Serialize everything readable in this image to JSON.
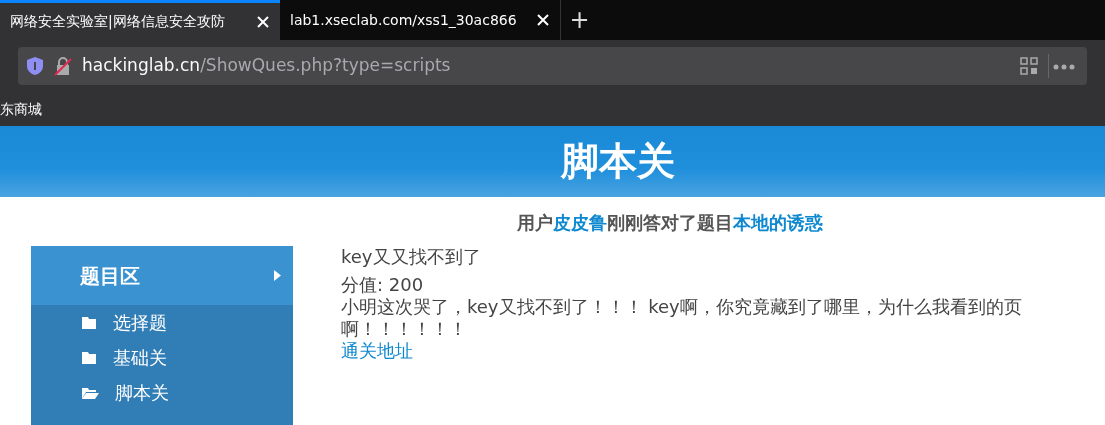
{
  "browser": {
    "tabs": [
      {
        "title": "网络安全实验室|网络信息安全攻防",
        "selected": true
      },
      {
        "title": "lab1.xseclab.com/xss1_30ac866",
        "selected": false
      }
    ],
    "new_tab": "+",
    "address": {
      "domain": "hackinglab.cn",
      "path": "/ShowQues.php?type=scripts"
    },
    "bookmarks": [
      "东商城"
    ]
  },
  "page": {
    "title": "脚本关",
    "notice_parts": [
      {
        "text": "用户",
        "kind": "plain"
      },
      {
        "text": "皮皮鲁",
        "kind": "link"
      },
      {
        "text": "刚刚答对了题目",
        "kind": "plain"
      },
      {
        "text": "本地的诱惑",
        "kind": "link"
      }
    ],
    "sidebar": {
      "header": "题目区",
      "items": [
        {
          "label": "选择题",
          "selected": false
        },
        {
          "label": "基础关",
          "selected": false
        },
        {
          "label": "脚本关",
          "selected": true
        }
      ]
    },
    "question": {
      "name": "key又又找不到了",
      "score": "分值: 200",
      "description": [
        "小明这次哭了，key又找不到了！！！ key啊，你究竟藏到了哪里，为什么我看到的页",
        "啊！！！！！！"
      ],
      "link": "通关地址"
    }
  }
}
